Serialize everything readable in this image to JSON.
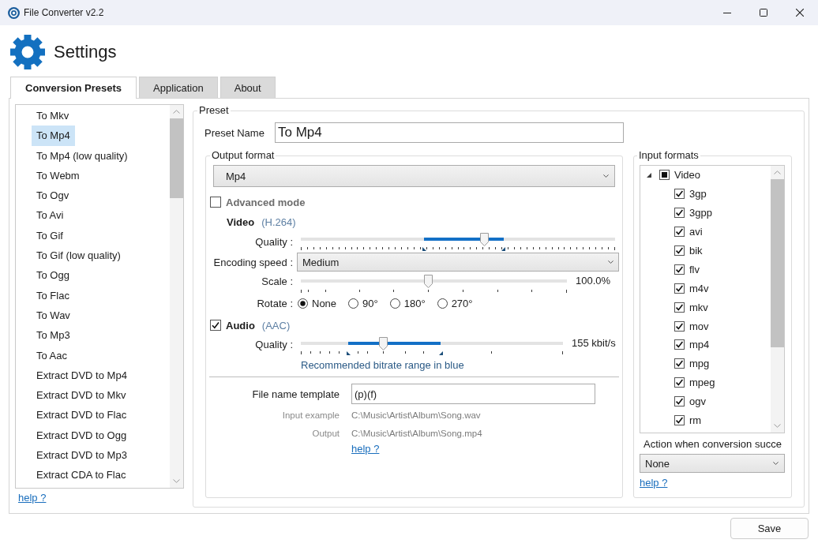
{
  "window": {
    "title": "File Converter v2.2"
  },
  "header": {
    "title": "Settings"
  },
  "tabs": [
    {
      "label": "Conversion Presets",
      "selected": true
    },
    {
      "label": "Application",
      "selected": false
    },
    {
      "label": "About",
      "selected": false
    }
  ],
  "presets": {
    "items": [
      {
        "label": "To Mkv",
        "selected": false
      },
      {
        "label": "To Mp4",
        "selected": true
      },
      {
        "label": "To Mp4 (low quality)",
        "selected": false
      },
      {
        "label": "To Webm",
        "selected": false
      },
      {
        "label": "To Ogv",
        "selected": false
      },
      {
        "label": "To Avi",
        "selected": false
      },
      {
        "label": "To Gif",
        "selected": false
      },
      {
        "label": "To Gif (low quality)",
        "selected": false
      },
      {
        "label": "To Ogg",
        "selected": false
      },
      {
        "label": "To Flac",
        "selected": false
      },
      {
        "label": "To Wav",
        "selected": false
      },
      {
        "label": "To Mp3",
        "selected": false
      },
      {
        "label": "To Aac",
        "selected": false
      },
      {
        "label": "Extract DVD to Mp4",
        "selected": false
      },
      {
        "label": "Extract DVD to Mkv",
        "selected": false
      },
      {
        "label": "Extract DVD to Flac",
        "selected": false
      },
      {
        "label": "Extract DVD to Ogg",
        "selected": false
      },
      {
        "label": "Extract DVD to Mp3",
        "selected": false
      },
      {
        "label": "Extract CDA to Flac",
        "selected": false
      }
    ],
    "help_link": "help ?"
  },
  "preset": {
    "group_label": "Preset",
    "name_label": "Preset Name",
    "name_value": "To Mp4",
    "output_format": {
      "group_label": "Output format",
      "format": "Mp4",
      "advanced_mode": {
        "label": "Advanced mode",
        "checked": false
      },
      "video": {
        "label": "Video",
        "codec": "(H.264)",
        "quality": {
          "label": "Quality :",
          "level": 0.585,
          "recommended_range": {
            "start": {
              "level": 0.392
            },
            "end": {
              "level": 0.645
            }
          }
        },
        "encoding_speed": {
          "label": "Encoding speed :",
          "value": "Medium"
        },
        "scale": {
          "label": "Scale :",
          "level": 0.48,
          "reading": "100.0%"
        },
        "rotate": {
          "label": "Rotate :",
          "options": [
            {
              "label": "None",
              "selected": true
            },
            {
              "label": "90°",
              "selected": false
            },
            {
              "label": "180°",
              "selected": false
            },
            {
              "label": "270°",
              "selected": false
            }
          ]
        }
      },
      "audio": {
        "label": "Audio",
        "codec": "(AAC)",
        "checked": true,
        "quality": {
          "label": "Quality :",
          "level": 0.315,
          "reading": "155 kbit/s",
          "recommended_range": {
            "start": {
              "level": 0.182
            },
            "end": {
              "level": 0.534
            }
          }
        },
        "hint": "Recommended bitrate range in blue"
      },
      "file_name_template": {
        "label": "File name template",
        "value": "(p)(f)"
      },
      "input_example": {
        "label": "Input example",
        "value": "C:\\Music\\Artist\\Album\\Song.wav"
      },
      "output_example": {
        "label": "Output",
        "value": "C:\\Music\\Artist\\Album\\Song.mp4"
      },
      "help_link": "help ?"
    },
    "input_formats": {
      "group_label": "Input formats",
      "tree": [
        {
          "label": "Video",
          "expanded": true,
          "checked": false,
          "partial": true,
          "children": [
            {
              "label": "3gp",
              "checked": true
            },
            {
              "label": "3gpp",
              "checked": true
            },
            {
              "label": "avi",
              "checked": true
            },
            {
              "label": "bik",
              "checked": true
            },
            {
              "label": "flv",
              "checked": true
            },
            {
              "label": "m4v",
              "checked": true
            },
            {
              "label": "mkv",
              "checked": true
            },
            {
              "label": "mov",
              "checked": true
            },
            {
              "label": "mp4",
              "checked": true
            },
            {
              "label": "mpg",
              "checked": true
            },
            {
              "label": "mpeg",
              "checked": true
            },
            {
              "label": "ogv",
              "checked": true
            },
            {
              "label": "rm",
              "checked": true
            }
          ]
        }
      ],
      "action_label": "Action when conversion succe",
      "action_value": "None",
      "help_link": "help ?"
    }
  },
  "buttons": [
    {
      "label": "Save"
    }
  ]
}
